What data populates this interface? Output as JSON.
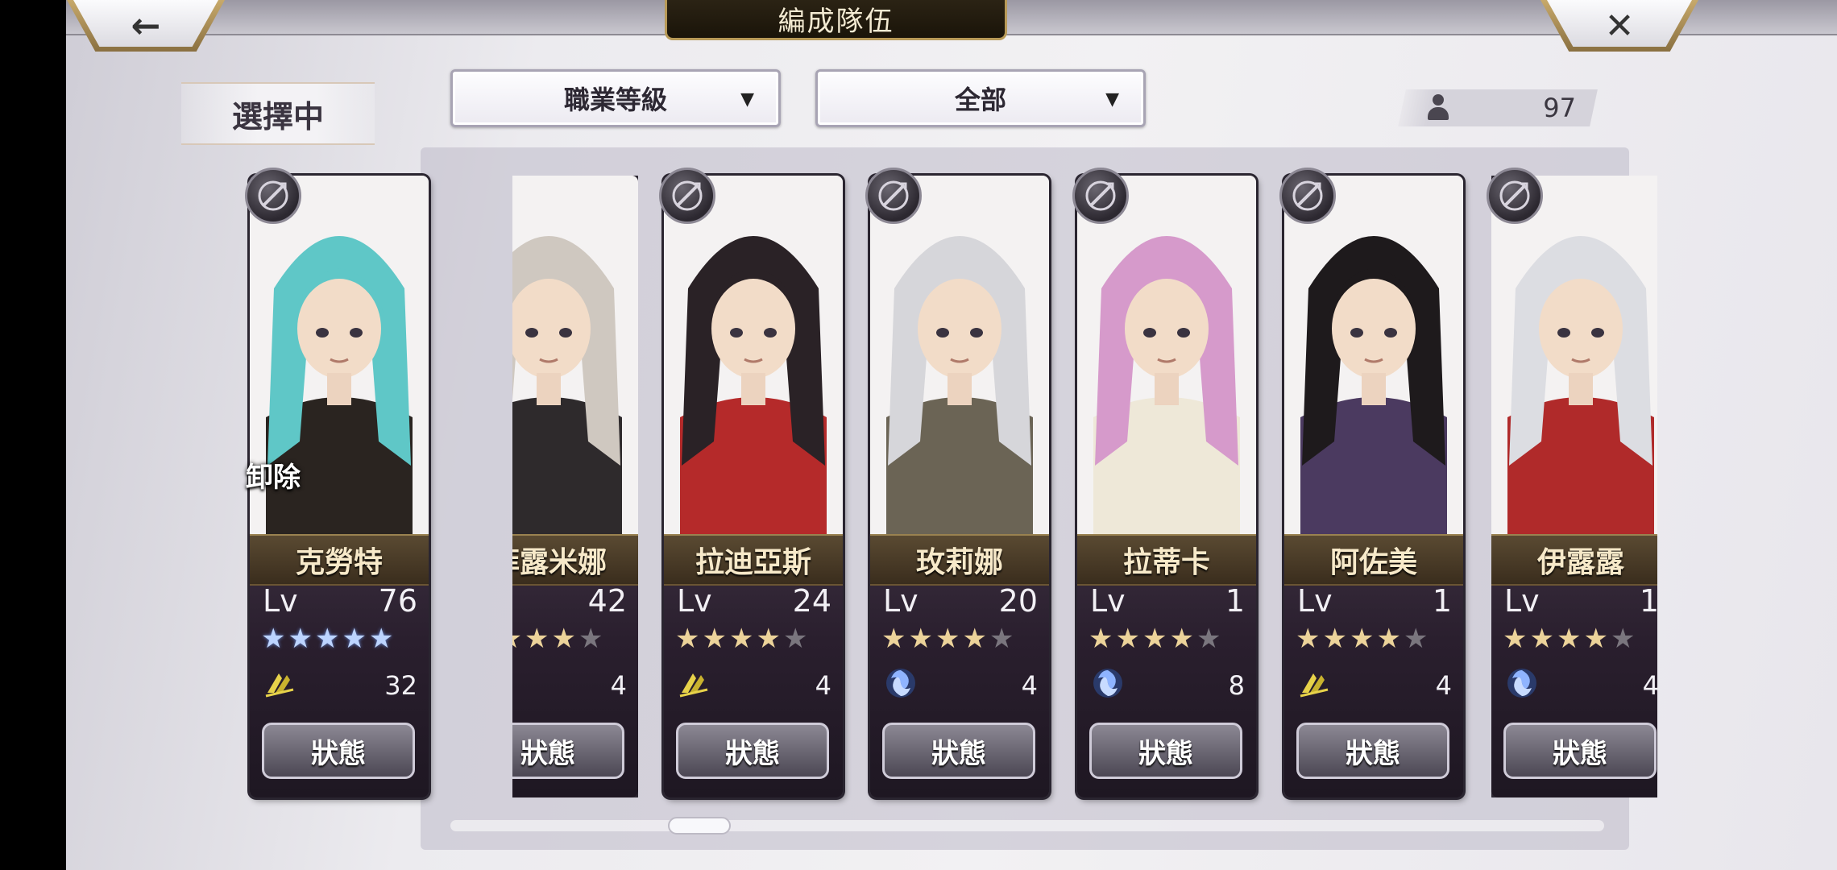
{
  "header": {
    "title": "編成隊伍",
    "back_glyph": "←",
    "close_glyph": "✕"
  },
  "selection": {
    "label": "選擇中",
    "unequip_label": "卸除"
  },
  "filters": {
    "job_sort": {
      "label": "職業等級",
      "caret": "▼"
    },
    "category": {
      "label": "全部",
      "caret": "▼"
    }
  },
  "unit_count": "97",
  "status_label": "狀態",
  "lv_label": "Lv",
  "colors": {
    "accent_gold": "#b89a58",
    "name_bar": "#4a3b27",
    "star_blue": "#bcd4ff",
    "star_gold": "#ecd39a",
    "star_empty": "#7a767e"
  },
  "selected_character": {
    "name": "克勞特",
    "level": "76",
    "stars": 5,
    "star_color": "blue",
    "element": "wind",
    "element_count": "32",
    "job_icon": "bow-icon",
    "hair": "#5fc7c7",
    "outfit": "#2a2420"
  },
  "characters": [
    {
      "name": "菲露米娜",
      "level": "42",
      "stars": 4,
      "element": "none",
      "element_count": "4",
      "job_icon": "none",
      "hair": "#cfc8c0",
      "outfit": "#2e2a2c"
    },
    {
      "name": "拉迪亞斯",
      "level": "24",
      "stars": 4,
      "element": "wind",
      "element_count": "4",
      "job_icon": "sword-icon",
      "hair": "#2a2226",
      "outfit": "#b52a2a"
    },
    {
      "name": "玫莉娜",
      "level": "20",
      "stars": 4,
      "element": "water",
      "element_count": "4",
      "job_icon": "fist-icon",
      "hair": "#d6d6da",
      "outfit": "#6b6455"
    },
    {
      "name": "拉蒂卡",
      "level": "1",
      "stars": 4,
      "element": "water",
      "element_count": "8",
      "job_icon": "staff-icon",
      "hair": "#d69acb",
      "outfit": "#eee8d8"
    },
    {
      "name": "阿佐美",
      "level": "1",
      "stars": 4,
      "element": "wind",
      "element_count": "4",
      "job_icon": "katana-icon",
      "hair": "#1e1a1c",
      "outfit": "#4b3a60"
    },
    {
      "name": "伊露露",
      "level": "1",
      "stars": 4,
      "element": "water",
      "element_count": "4",
      "job_icon": "axe-icon",
      "hair": "#dcdde2",
      "outfit": "#b02a2a"
    }
  ]
}
